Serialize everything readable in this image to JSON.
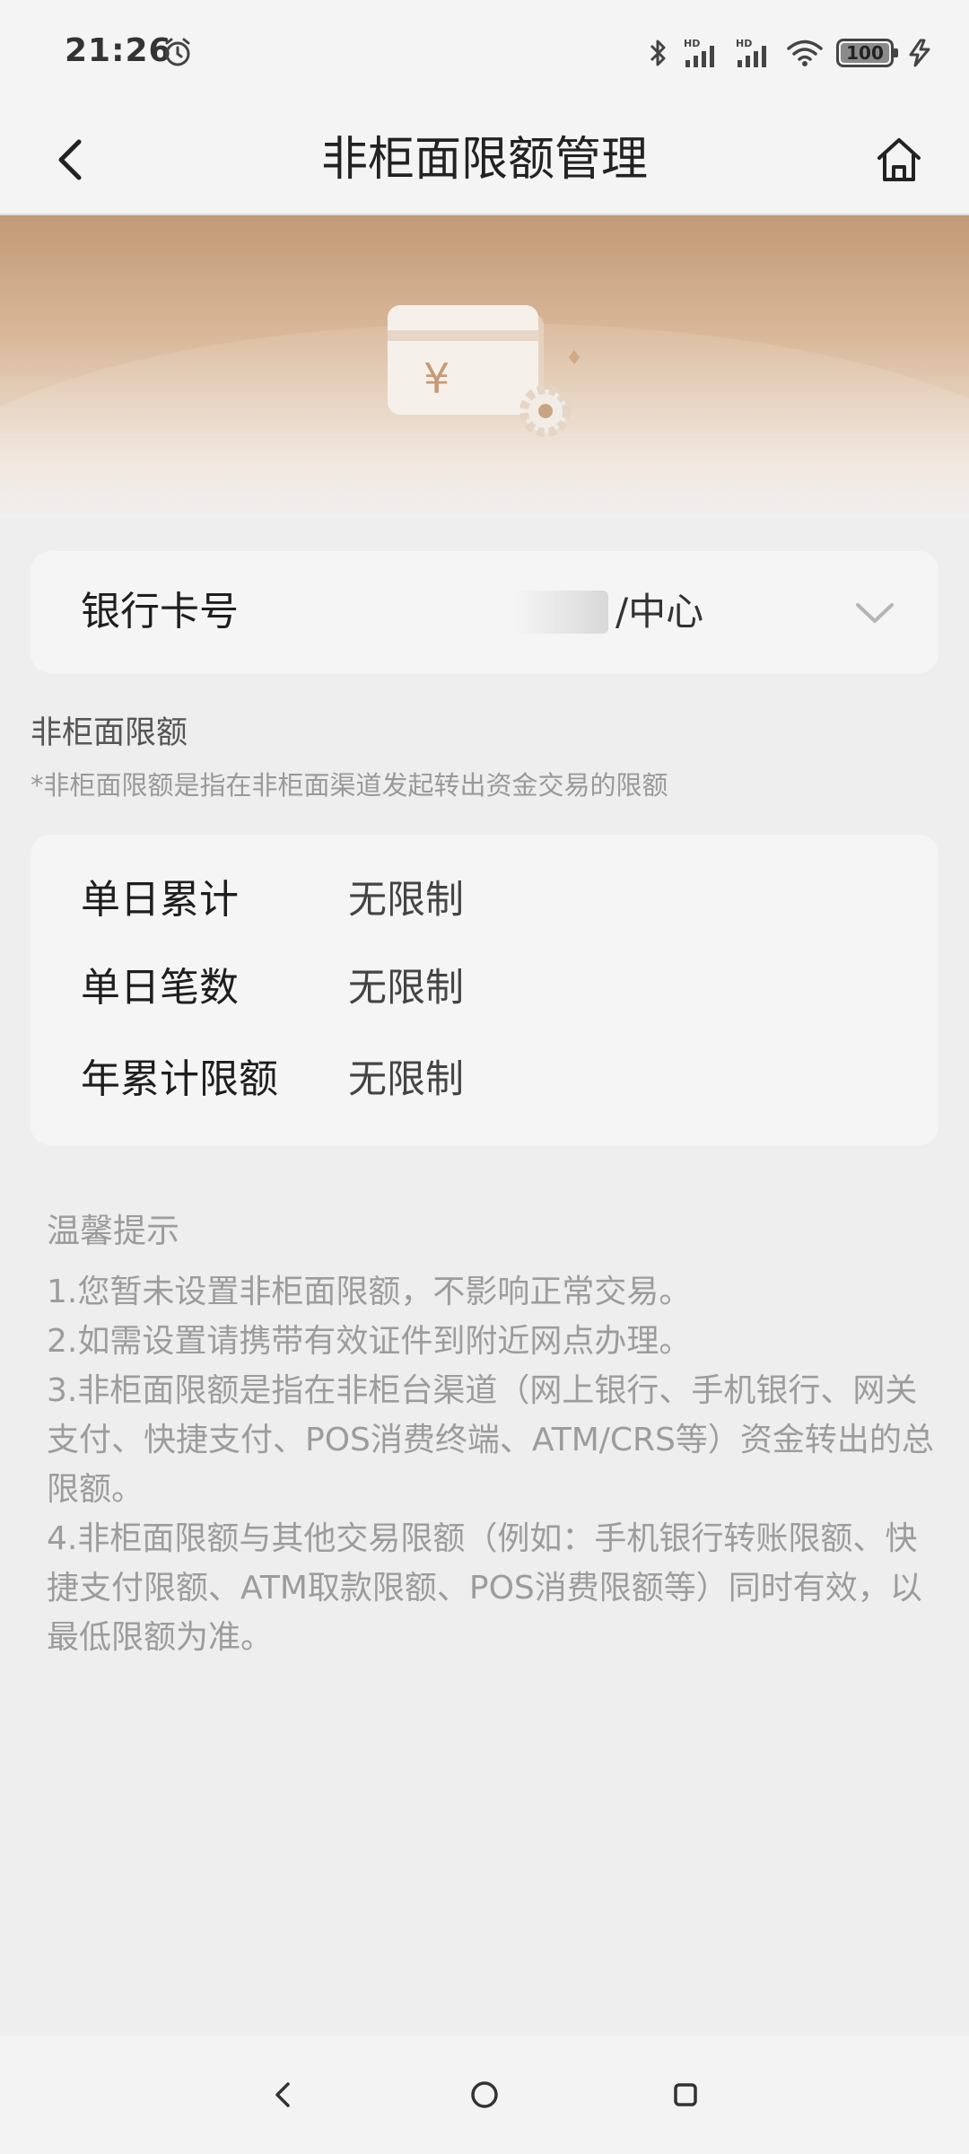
{
  "status_bar": {
    "time": "21:26",
    "battery": "100",
    "icons": [
      "alarm-icon",
      "bluetooth-icon",
      "signal-hd-icon",
      "signal-hd-icon",
      "wifi-icon",
      "battery-icon",
      "charging-icon"
    ]
  },
  "header": {
    "title": "非柜面限额管理",
    "back_icon": "chevron-left-icon",
    "home_icon": "home-icon"
  },
  "banner": {
    "illustration": "card-settings-icon",
    "currency_symbol": "¥"
  },
  "card_select": {
    "label": "银行卡号",
    "value": "/中心",
    "icon": "chevron-down-icon"
  },
  "limits": {
    "title": "非柜面限额",
    "note": "*非柜面限额是指在非柜面渠道发起转出资金交易的限额",
    "rows": [
      {
        "label": "单日累计",
        "value": "无限制"
      },
      {
        "label": "单日笔数",
        "value": "无限制"
      },
      {
        "label": "年累计限额",
        "value": "无限制"
      }
    ]
  },
  "tips": {
    "title": "温馨提示",
    "items": [
      "1.您暂未设置非柜面限额，不影响正常交易。",
      "2.如需设置请携带有效证件到附近网点办理。",
      "3.非柜面限额是指在非柜台渠道（网上银行、手机银行、网关支付、快捷支付、POS消费终端、ATM/CRS等）资金转出的总限额。",
      "4.非柜面限额与其他交易限额（例如：手机银行转账限额、快捷支付限额、ATM取款限额、POS消费限额等）同时有效，以最低限额为准。"
    ]
  },
  "nav_bar": {
    "icons": [
      "nav-back-icon",
      "nav-home-icon",
      "nav-recents-icon"
    ]
  }
}
